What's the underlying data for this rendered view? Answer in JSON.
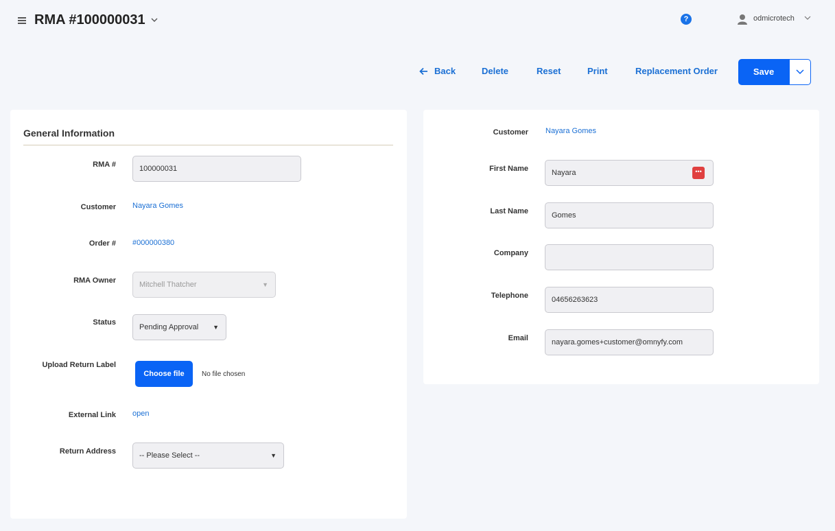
{
  "header": {
    "title": "RMA #100000031",
    "help_icon": "?",
    "username": "odmicrotech"
  },
  "actions": {
    "back": "Back",
    "delete": "Delete",
    "reset": "Reset",
    "print": "Print",
    "replacement_order": "Replacement Order",
    "save": "Save"
  },
  "general": {
    "section_title": "General Information",
    "rma_label": "RMA #",
    "rma_value": "100000031",
    "customer_label": "Customer",
    "customer_value": "Nayara Gomes",
    "order_label": "Order #",
    "order_value": "#000000380",
    "owner_label": "RMA Owner",
    "owner_value": "Mitchell Thatcher",
    "status_label": "Status",
    "status_value": "Pending Approval",
    "upload_label": "Upload Return Label",
    "choose_file": "Choose file",
    "no_file": "No file chosen",
    "external_label": "External Link",
    "external_value": "open",
    "return_label": "Return Address",
    "return_value": "-- Please Select --"
  },
  "customer_info": {
    "customer_label": "Customer",
    "customer_value": "Nayara Gomes",
    "first_name_label": "First Name",
    "first_name_value": "Nayara",
    "last_name_label": "Last Name",
    "last_name_value": "Gomes",
    "company_label": "Company",
    "company_value": "",
    "telephone_label": "Telephone",
    "telephone_value": "04656263623",
    "email_label": "Email",
    "email_value": "nayara.gomes+customer@omnyfy.com"
  },
  "colors": {
    "accent": "#0a64f5",
    "link": "#1a6fd4",
    "background": "#f4f6fa"
  },
  "icons": {
    "menu": "hamburger-icon",
    "title_dropdown": "chevron-down-icon",
    "help": "help-icon",
    "user": "user-icon",
    "back": "arrow-left-icon",
    "password_manager": "password-manager-icon"
  }
}
